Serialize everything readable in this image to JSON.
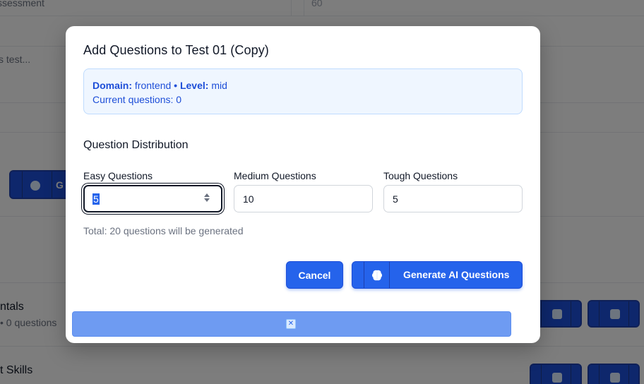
{
  "background": {
    "row1_text": "ssessment",
    "row1_value": "60",
    "row2_text": "s test...",
    "item1_title": "ntals",
    "item1_sub": "• 0 questions",
    "item2_title": "t Skills",
    "left_btn_label": "G"
  },
  "modal": {
    "title": "Add Questions to Test 01 (Copy)",
    "info": {
      "domain_label": "Domain:",
      "domain_value": "frontend",
      "separator": "•",
      "level_label": "Level:",
      "level_value": "mid",
      "current_label": "Current questions:",
      "current_value": "0"
    },
    "section_title": "Question Distribution",
    "fields": {
      "easy": {
        "label": "Easy Questions",
        "value": "5"
      },
      "medium": {
        "label": "Medium Questions",
        "value": "10"
      },
      "tough": {
        "label": "Tough Questions",
        "value": "5"
      }
    },
    "total_text": "Total: 20 questions will be generated",
    "cancel_label": "Cancel",
    "generate_label": "Generate AI Questions",
    "toast_close_glyph": "✕"
  },
  "colors": {
    "primary": "#2563eb",
    "info_bg": "#eff6ff",
    "info_text": "#1d4ed8",
    "toast_bg": "#6e9bf2"
  },
  "icons": [
    "brain-icon",
    "close-icon",
    "edit-icon",
    "copy-icon",
    "spinner-icon"
  ]
}
